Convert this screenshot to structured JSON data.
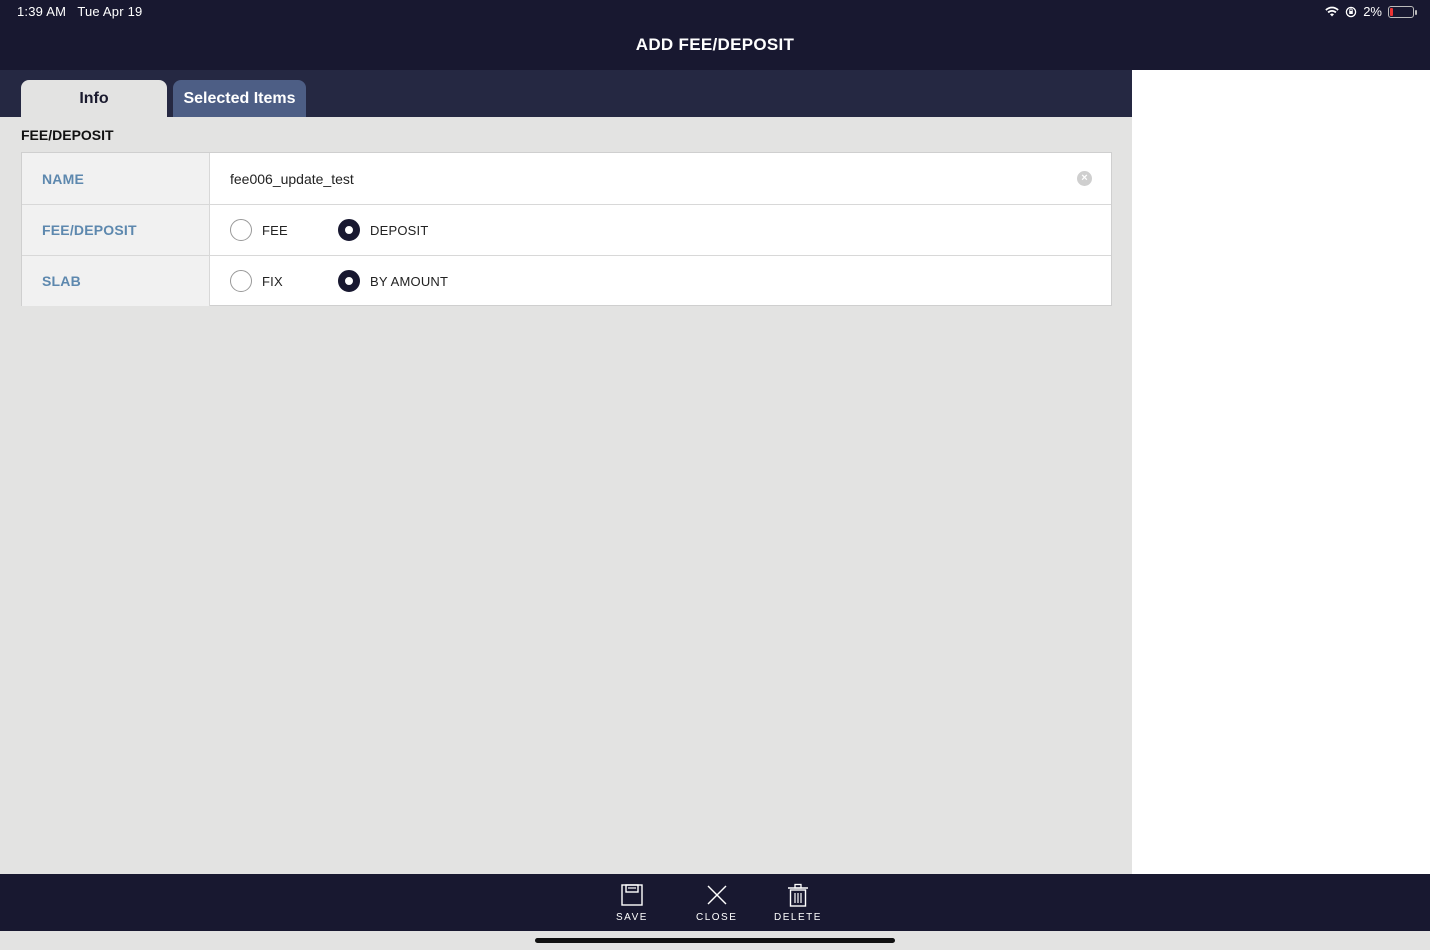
{
  "status_bar": {
    "time": "1:39 AM",
    "date": "Tue Apr 19",
    "battery": "2%"
  },
  "header": {
    "title": "ADD FEE/DEPOSIT"
  },
  "tabs": [
    {
      "label": "Info",
      "active": true
    },
    {
      "label": "Selected Items",
      "active": false
    }
  ],
  "section": {
    "title": "FEE/DEPOSIT"
  },
  "form": {
    "name": {
      "label": "NAME",
      "value": "fee006_update_test"
    },
    "fee_deposit": {
      "label": "FEE/DEPOSIT",
      "options": [
        {
          "label": "FEE",
          "checked": false
        },
        {
          "label": "DEPOSIT",
          "checked": true
        }
      ]
    },
    "slab": {
      "label": "SLAB",
      "options": [
        {
          "label": "FIX",
          "checked": false
        },
        {
          "label": "BY AMOUNT",
          "checked": true
        }
      ]
    }
  },
  "footer": {
    "save": "SAVE",
    "close": "CLOSE",
    "delete": "DELETE"
  },
  "colors": {
    "header_bg": "#181830",
    "tabbar_bg": "#252842",
    "tab_inactive": "#4d5e85",
    "label_blue": "#5d88ae",
    "content_bg": "#e3e3e2"
  }
}
